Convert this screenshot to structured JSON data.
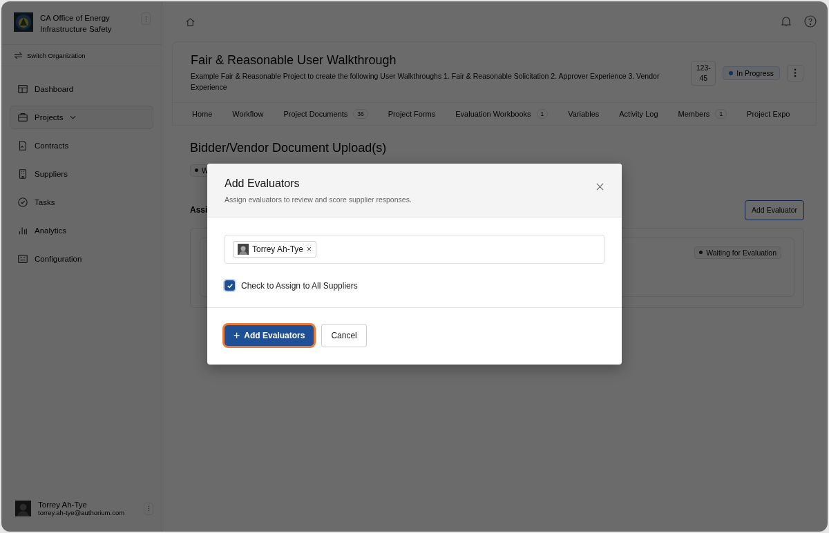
{
  "sidebar": {
    "org_name": "CA Office of Energy Infrastructure Safety",
    "switch_label": "Switch Organization",
    "items": [
      {
        "label": "Dashboard",
        "selected": false,
        "expandable": false
      },
      {
        "label": "Projects",
        "selected": true,
        "expandable": true
      },
      {
        "label": "Contracts",
        "selected": false,
        "expandable": false
      },
      {
        "label": "Suppliers",
        "selected": false,
        "expandable": false
      },
      {
        "label": "Tasks",
        "selected": false,
        "expandable": false
      },
      {
        "label": "Analytics",
        "selected": false,
        "expandable": false
      },
      {
        "label": "Configuration",
        "selected": false,
        "expandable": false
      }
    ],
    "user": {
      "name": "Torrey Ah-Tye",
      "email": "torrey.ah-tye@authorium.com"
    }
  },
  "project": {
    "title": "Fair & Reasonable User Walkthrough",
    "description": "Example Fair & Reasonable Project to create the following User Walkthroughs 1. Fair & Reasonable Solicitation 2. Approver Experience 3. Vendor Experience",
    "number": "123-45",
    "status": "In Progress"
  },
  "tabs": [
    {
      "label": "Home"
    },
    {
      "label": "Workflow"
    },
    {
      "label": "Project Documents",
      "count": "36"
    },
    {
      "label": "Project Forms"
    },
    {
      "label": "Evaluation Workbooks",
      "count": "1"
    },
    {
      "label": "Variables"
    },
    {
      "label": "Activity Log"
    },
    {
      "label": "Members",
      "count": "1"
    },
    {
      "label": "Project Expo"
    }
  ],
  "section": {
    "title": "Bidder/Vendor Document Upload(s)",
    "badge": "W",
    "subheading": "Assi",
    "add_button": "Add Evaluator",
    "row_status": "Waiting for Evaluation"
  },
  "modal": {
    "title": "Add Evaluators",
    "subtitle": "Assign evaluators to review and score supplier responses.",
    "chips": [
      {
        "label": "Torrey Ah-Tye"
      }
    ],
    "remove_glyph": "×",
    "checkbox": {
      "label": "Check to Assign to All Suppliers",
      "checked": true
    },
    "primary": "Add Evaluators",
    "primary_glyph": "+",
    "secondary": "Cancel"
  }
}
